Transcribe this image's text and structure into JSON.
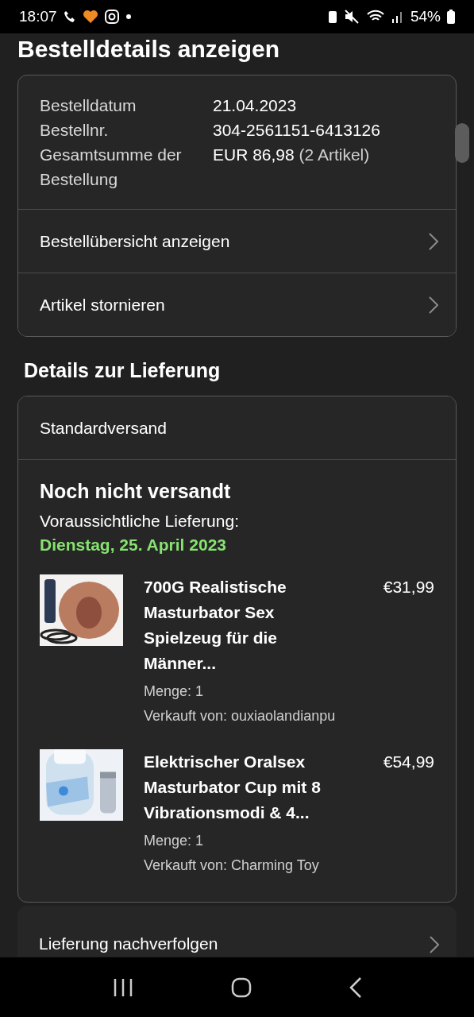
{
  "status_bar": {
    "time": "18:07",
    "battery": "54%"
  },
  "title": "Bestelldetails anzeigen",
  "order_info": [
    {
      "label": "Bestelldatum",
      "value": "21.04.2023"
    },
    {
      "label": "Bestellnr.",
      "value": "304-2561151-6413126"
    },
    {
      "label": "Gesamtsumme der Bestellung",
      "value": "EUR 86,98",
      "note": "(2 Artikel)"
    }
  ],
  "order_links": [
    "Bestellübersicht anzeigen",
    "Artikel stornieren"
  ],
  "delivery": {
    "heading": "Details zur Lieferung",
    "method": "Standardversand",
    "status": "Noch nicht versandt",
    "estimate_label": "Voraussichtliche Lieferung:",
    "estimate_date": "Dienstag, 25. April 2023",
    "items": [
      {
        "title": "700G Realistische Masturbator Sex Spielzeug für die Männer...",
        "price": "€31,99",
        "quantity": "Menge: 1",
        "seller": "Verkauft von: ouxiaolandianpu"
      },
      {
        "title": "Elektrischer Oralsex Masturbator Cup mit 8 Vibrationsmodi & 4...",
        "price": "€54,99",
        "quantity": "Menge: 1",
        "seller": "Verkauft von: Charming Toy"
      }
    ],
    "track_link": "Lieferung nachverfolgen"
  }
}
